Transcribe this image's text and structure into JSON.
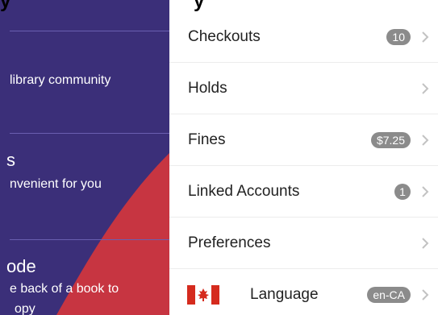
{
  "left_panel": {
    "texts": {
      "community": "library community",
      "s": "s",
      "nvenient": "nvenient for you",
      "ode": "ode",
      "e_back": "e back of a book to",
      "opy": "opy"
    },
    "colors": {
      "bg": "#3b2f79",
      "accent": "#c73541"
    }
  },
  "top_cut": {
    "left": "y",
    "right": "y"
  },
  "menu": [
    {
      "label": "Checkouts",
      "badge": "10"
    },
    {
      "label": "Holds",
      "badge": ""
    },
    {
      "label": "Fines",
      "badge": "$7.25"
    },
    {
      "label": "Linked Accounts",
      "badge": "1"
    },
    {
      "label": "Preferences",
      "badge": ""
    },
    {
      "label": "Language",
      "badge": "en-CA",
      "icon": "canada-flag-icon"
    }
  ],
  "colors": {
    "badge": "#8b8b8b",
    "divider": "#ececec",
    "chevron": "#c2c2c2"
  }
}
